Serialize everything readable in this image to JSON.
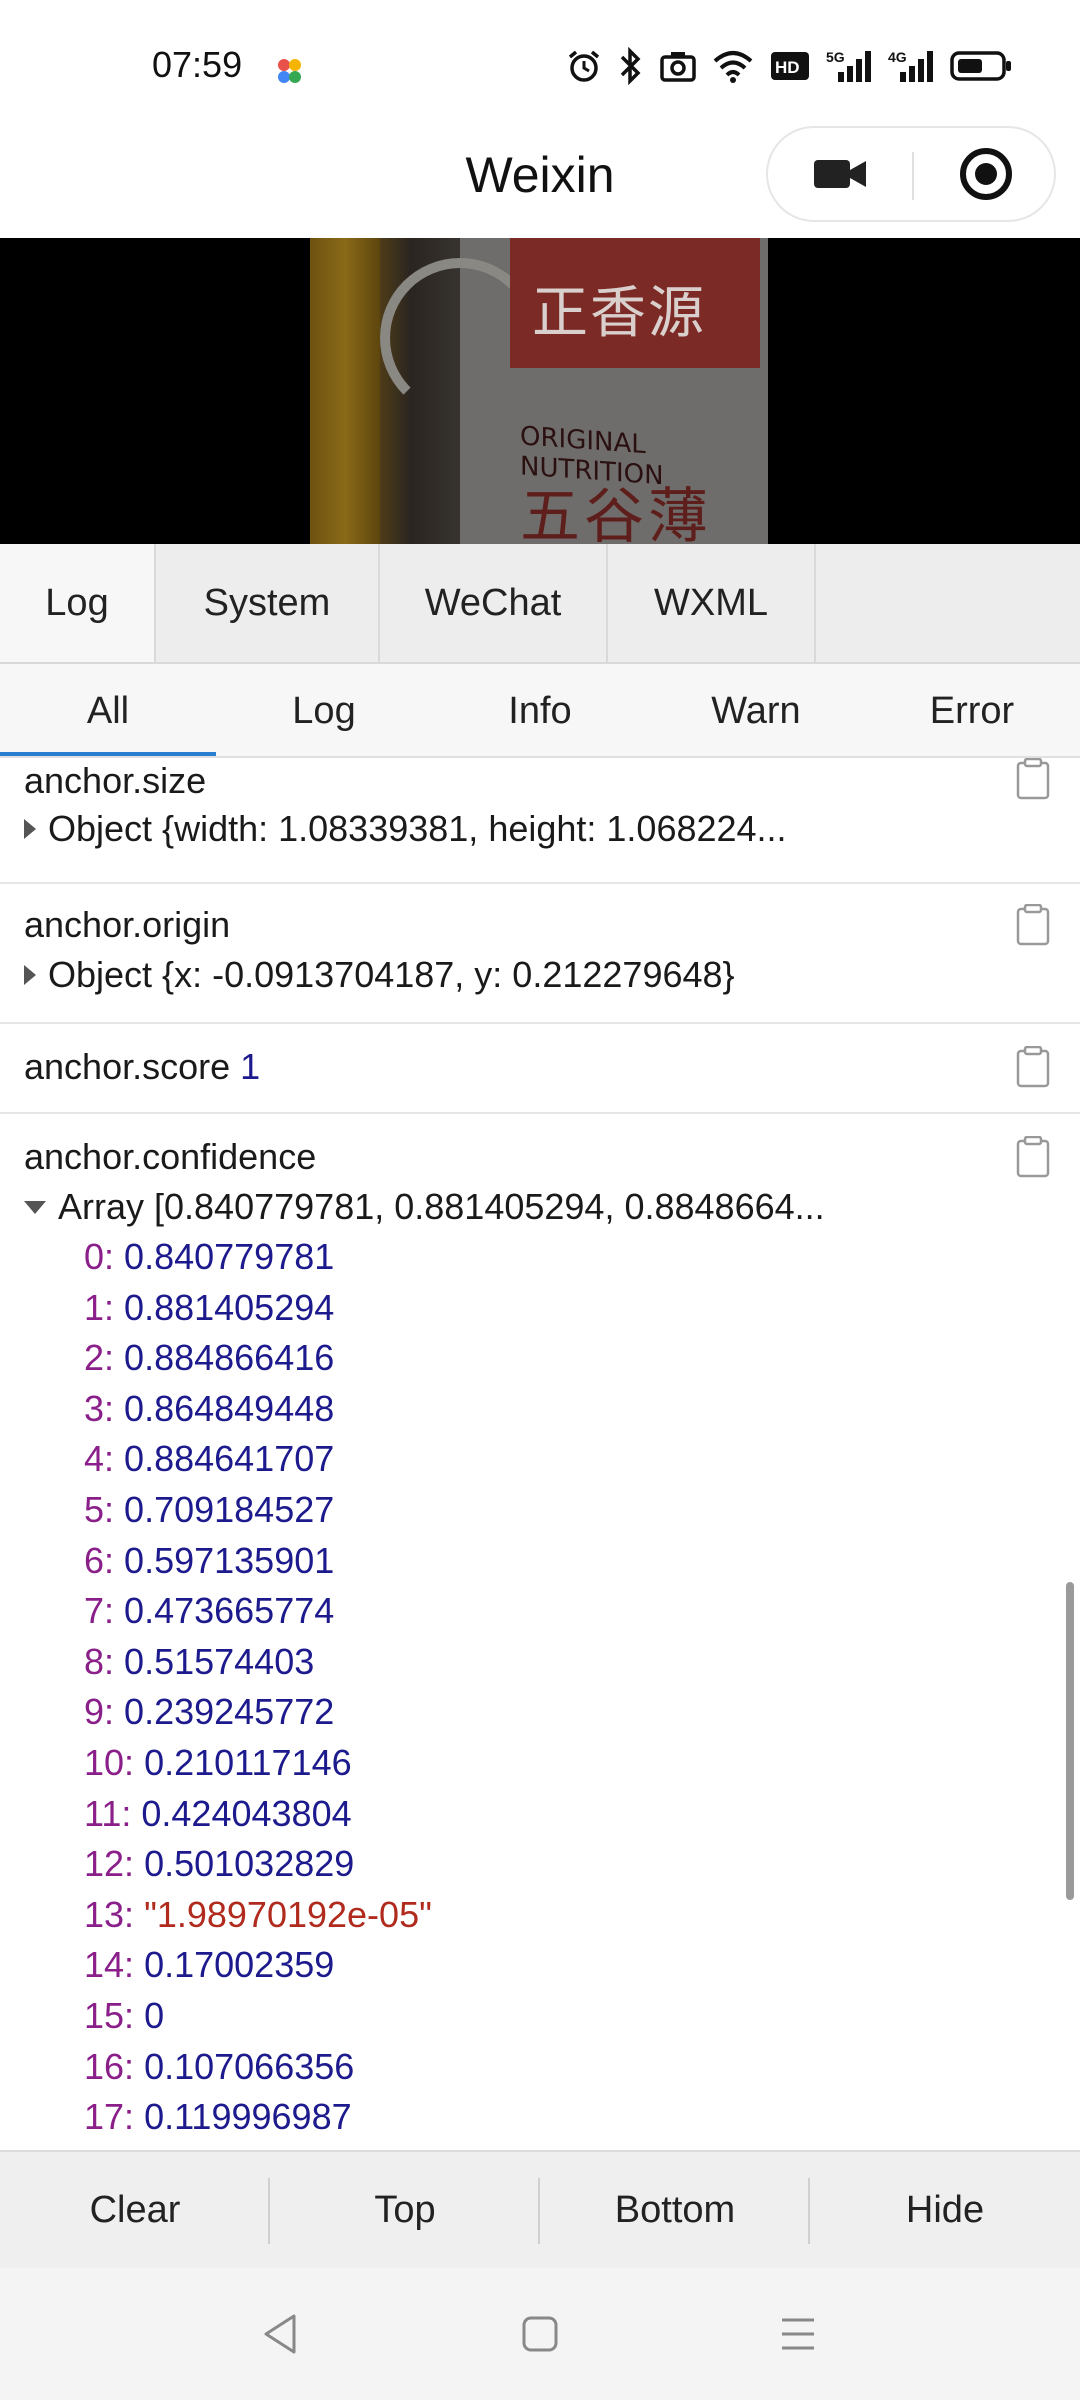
{
  "status_bar": {
    "time": "07:59",
    "icons": [
      "alarm-icon",
      "bluetooth-icon",
      "camera-icon",
      "wifi-icon",
      "hd-icon",
      "5g-signal-icon",
      "4g-signal-icon",
      "battery-icon"
    ],
    "hd_label": "HD",
    "net1_label": "5G",
    "net2_label": "4G"
  },
  "title_bar": {
    "title": "Weixin",
    "capsule_icons": [
      "video-camera-icon",
      "record-target-icon"
    ]
  },
  "camera_preview": {
    "pack_text_top": "正香源",
    "pack_text_sub": "ORIGINAL NUTRITION",
    "pack_text_big": "五谷薄饼"
  },
  "console": {
    "tabs": [
      {
        "label": "Log",
        "active": true
      },
      {
        "label": "System",
        "active": false
      },
      {
        "label": "WeChat",
        "active": false
      },
      {
        "label": "WXML",
        "active": false
      }
    ],
    "filters": [
      {
        "label": "All",
        "active": true
      },
      {
        "label": "Log",
        "active": false
      },
      {
        "label": "Info",
        "active": false
      },
      {
        "label": "Warn",
        "active": false
      },
      {
        "label": "Error",
        "active": false
      }
    ],
    "entries": {
      "size": {
        "title": "anchor.size",
        "object": "Object {width: 1.08339381, height: 1.068224..."
      },
      "origin": {
        "title": "anchor.origin",
        "object": "Object {x: -0.0913704187, y: 0.212279648}"
      },
      "score": {
        "title": "anchor.score",
        "value": "1"
      },
      "confidence": {
        "title": "anchor.confidence",
        "array": "Array [0.840779781, 0.881405294, 0.8848664...",
        "items": [
          {
            "key": "0",
            "value": "0.840779781"
          },
          {
            "key": "1",
            "value": "0.881405294"
          },
          {
            "key": "2",
            "value": "0.884866416"
          },
          {
            "key": "3",
            "value": "0.864849448"
          },
          {
            "key": "4",
            "value": "0.884641707"
          },
          {
            "key": "5",
            "value": "0.709184527"
          },
          {
            "key": "6",
            "value": "0.597135901"
          },
          {
            "key": "7",
            "value": "0.473665774"
          },
          {
            "key": "8",
            "value": "0.51574403"
          },
          {
            "key": "9",
            "value": "0.239245772"
          },
          {
            "key": "10",
            "value": "0.210117146"
          },
          {
            "key": "11",
            "value": "0.424043804"
          },
          {
            "key": "12",
            "value": "0.501032829"
          },
          {
            "key": "13",
            "value": "\"1.98970192e-05\""
          },
          {
            "key": "14",
            "value": "0.17002359"
          },
          {
            "key": "15",
            "value": "0"
          },
          {
            "key": "16",
            "value": "0.107066356"
          },
          {
            "key": "17",
            "value": "0.119996987"
          }
        ]
      }
    },
    "toolbar": {
      "clear": "Clear",
      "top": "Top",
      "bottom": "Bottom",
      "hide": "Hide"
    }
  },
  "nav_bar": {
    "icons": [
      "back-icon",
      "home-icon",
      "recents-icon"
    ]
  },
  "colors": {
    "accent": "#2b7fd1",
    "array_key": "#8a1f8a",
    "number": "#1c1a8c",
    "string": "#b02a1e"
  }
}
